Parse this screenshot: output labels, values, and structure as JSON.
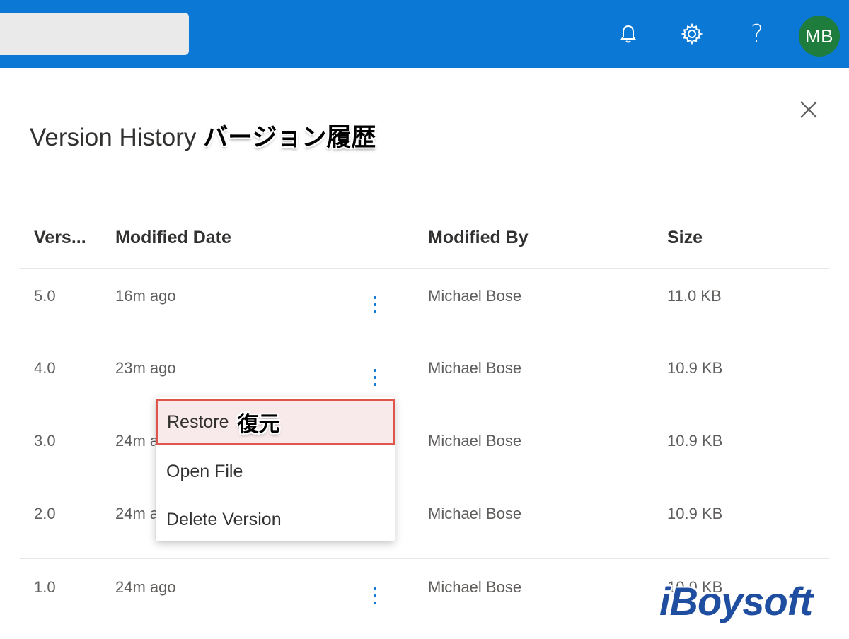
{
  "header": {
    "avatar_initials": "MB",
    "icons": [
      "bell-icon",
      "gear-icon",
      "help-icon"
    ],
    "help_glyph": "?"
  },
  "panel": {
    "title": "Version History",
    "title_annotation": "バージョン履歴"
  },
  "table": {
    "columns": [
      "Vers...",
      "Modified Date",
      "Modified By",
      "Size"
    ],
    "rows": [
      {
        "version": "5.0",
        "modified_date": "16m ago",
        "modified_by": "Michael Bose",
        "size": "11.0 KB"
      },
      {
        "version": "4.0",
        "modified_date": "23m ago",
        "modified_by": "Michael Bose",
        "size": "10.9 KB"
      },
      {
        "version": "3.0",
        "modified_date": "24m a",
        "modified_by": "Michael Bose",
        "size": "10.9 KB"
      },
      {
        "version": "2.0",
        "modified_date": "24m a",
        "modified_by": "Michael Bose",
        "size": "10.9 KB"
      },
      {
        "version": "1.0",
        "modified_date": "24m ago",
        "modified_by": "Michael Bose",
        "size": "10.9 KB"
      }
    ]
  },
  "context_menu": {
    "restore": "Restore",
    "restore_annotation": "復元",
    "open_file": "Open File",
    "delete_version": "Delete Version"
  },
  "watermark": "iBoysoft",
  "colors": {
    "header_bg": "#0a78d4",
    "avatar_bg": "#1e7d3c",
    "highlight_border": "#e0554b",
    "highlight_bg": "#f8eaea",
    "accent": "#0a78d4"
  }
}
